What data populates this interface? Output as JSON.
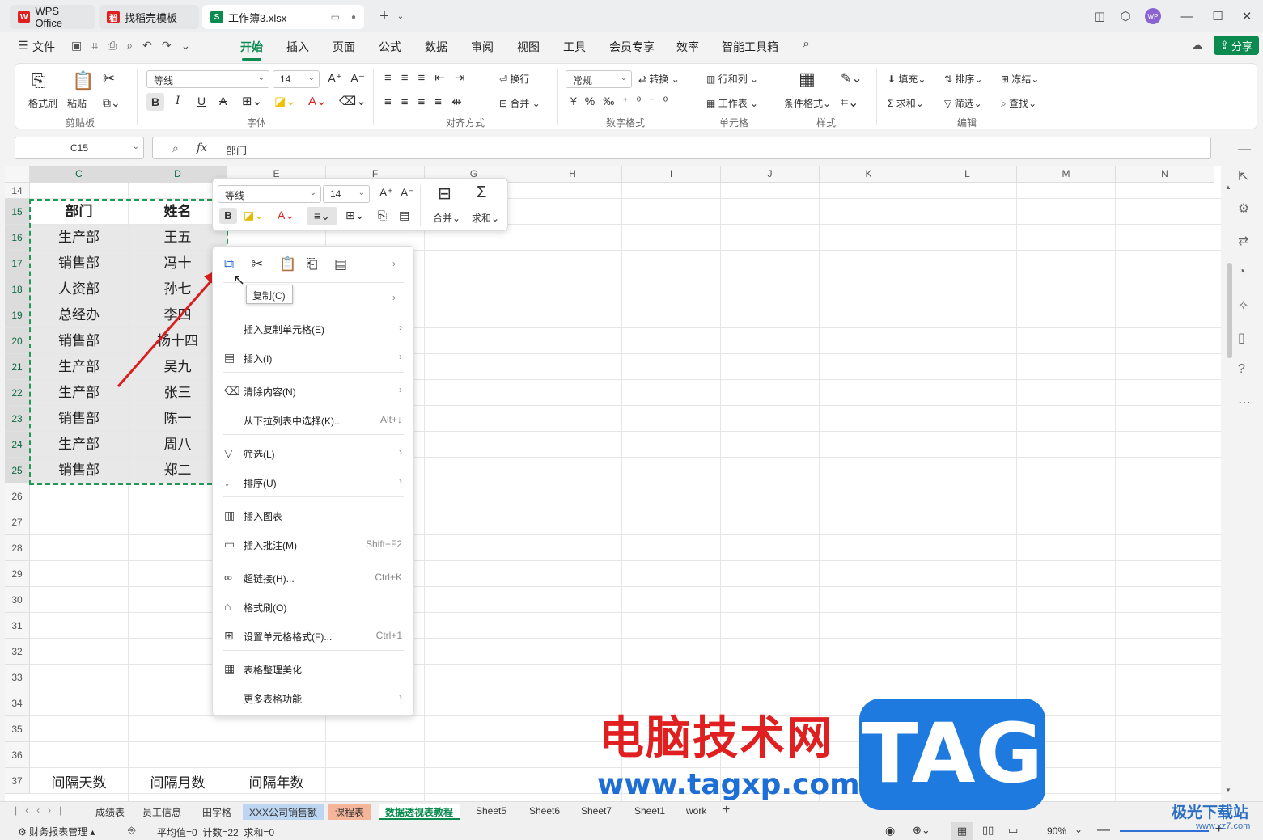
{
  "tabs": [
    {
      "label": "WPS Office",
      "color": "#e02020",
      "icon": "W"
    },
    {
      "label": "找稻壳模板",
      "color": "#e02020",
      "icon": "稻"
    },
    {
      "label": "工作簿3.xlsx",
      "color": "#0b8b4f",
      "icon": "S"
    }
  ],
  "menu": {
    "file": "文件",
    "items": [
      "开始",
      "插入",
      "页面",
      "公式",
      "数据",
      "审阅",
      "视图",
      "工具",
      "会员专享",
      "效率",
      "智能工具箱"
    ],
    "share": "分享"
  },
  "ribbon": {
    "format_painter": "格式刷",
    "paste": "粘贴",
    "font_name": "等线",
    "font_size": "14",
    "wrap": "换行",
    "merge": "合并",
    "number_format": "常规",
    "convert": "转换",
    "row_col": "行和列",
    "worksheet": "工作表",
    "cond_format": "条件格式",
    "fill": "填充",
    "sort": "排序",
    "freeze": "冻结",
    "sum": "求和",
    "filter": "筛选",
    "find": "查找",
    "groups": [
      "剪贴板",
      "字体",
      "对齐方式",
      "数字格式",
      "单元格",
      "样式",
      "编辑"
    ]
  },
  "formula": {
    "name_box": "C15",
    "fx": "fx",
    "content": "部门"
  },
  "columns": [
    "C",
    "D",
    "E",
    "F",
    "G",
    "H",
    "I",
    "J",
    "K",
    "L",
    "M",
    "N"
  ],
  "rows": [
    "14",
    "15",
    "16",
    "17",
    "18",
    "19",
    "20",
    "21",
    "22",
    "23",
    "24",
    "25",
    "26",
    "27",
    "28",
    "29",
    "30",
    "31",
    "32",
    "33",
    "34",
    "35",
    "36",
    "37"
  ],
  "table": {
    "headers": [
      "部门",
      "姓名"
    ],
    "data": [
      [
        "生产部",
        "王五"
      ],
      [
        "销售部",
        "冯十"
      ],
      [
        "人资部",
        "孙七"
      ],
      [
        "总经办",
        "李四"
      ],
      [
        "销售部",
        "杨十四"
      ],
      [
        "生产部",
        "吴九"
      ],
      [
        "生产部",
        "张三"
      ],
      [
        "销售部",
        "陈一"
      ],
      [
        "生产部",
        "周八"
      ],
      [
        "销售部",
        "郑二"
      ]
    ]
  },
  "row37": [
    "间隔天数",
    "间隔月数",
    "间隔年数"
  ],
  "mini_toolbar": {
    "font": "等线",
    "size": "14",
    "merge": "合并",
    "sum": "求和"
  },
  "context_menu": [
    {
      "label": "插入复制单元格(E)",
      "shortcut": "",
      "arrow": true,
      "icon": ""
    },
    {
      "label": "插入(I)",
      "shortcut": "",
      "arrow": true,
      "icon": "▤"
    },
    {
      "label": "清除内容(N)",
      "shortcut": "",
      "arrow": true,
      "icon": "⌫"
    },
    {
      "label": "从下拉列表中选择(K)...",
      "shortcut": "Alt+↓",
      "arrow": false,
      "icon": ""
    },
    {
      "label": "筛选(L)",
      "shortcut": "",
      "arrow": true,
      "icon": "▽"
    },
    {
      "label": "排序(U)",
      "shortcut": "",
      "arrow": true,
      "icon": "↓"
    },
    {
      "label": "插入图表",
      "shortcut": "",
      "arrow": false,
      "icon": "▥"
    },
    {
      "label": "插入批注(M)",
      "shortcut": "Shift+F2",
      "arrow": false,
      "icon": "▭"
    },
    {
      "label": "超链接(H)...",
      "shortcut": "Ctrl+K",
      "arrow": false,
      "icon": "∞"
    },
    {
      "label": "格式刷(O)",
      "shortcut": "",
      "arrow": false,
      "icon": "⌂"
    },
    {
      "label": "设置单元格格式(F)...",
      "shortcut": "Ctrl+1",
      "arrow": false,
      "icon": "⊞"
    },
    {
      "label": "表格整理美化",
      "shortcut": "",
      "arrow": false,
      "icon": "▦"
    },
    {
      "label": "更多表格功能",
      "shortcut": "",
      "arrow": true,
      "icon": ""
    }
  ],
  "tooltip": "复制(C)",
  "sheet_tabs": [
    "成绩表",
    "员工信息",
    "田字格",
    "XXX公司销售额",
    "课程表",
    "数据透视表教程",
    "Sheet5",
    "Sheet6",
    "Sheet7",
    "Sheet1",
    "work"
  ],
  "status": {
    "left": "财务报表管理",
    "stats": "平均值=0  计数=22  求和=0",
    "zoom": "90%"
  },
  "watermark": {
    "cn": "电脑技术网",
    "url": "www.tagxp.com",
    "tag": "TAG",
    "site": "极光下载站",
    "site_url": "www.xz7.com"
  }
}
